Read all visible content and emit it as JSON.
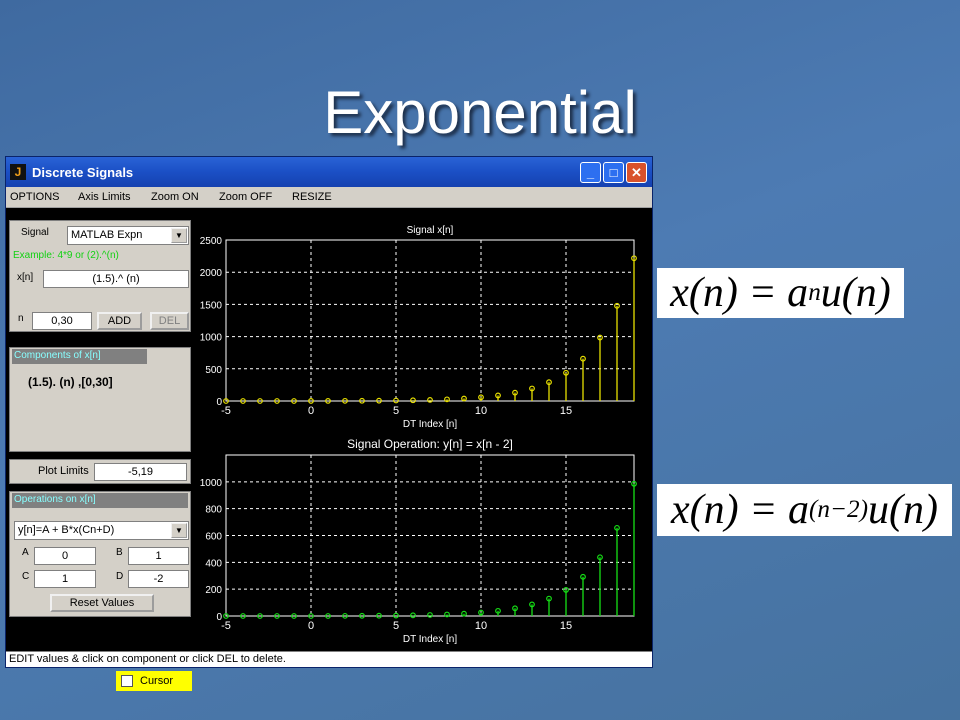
{
  "slide": {
    "title": "Exponential",
    "formula1": {
      "base": "x(n) = a",
      "exp": "n",
      "tail": "u(n)"
    },
    "formula2": {
      "base": "x(n) = a",
      "exp": "(n−2)",
      "tail": "u(n)"
    }
  },
  "window": {
    "title": "Discrete Signals",
    "menu": [
      "OPTIONS",
      "Axis Limits",
      "Zoom ON",
      "Zoom OFF",
      "RESIZE"
    ],
    "status": "EDIT values & click on component or click DEL to delete."
  },
  "signal_panel": {
    "signal_label": "Signal",
    "signal_select": "MATLAB Expn",
    "example": "Example: 4*9 or (2).^(n)",
    "xn_label": "x[n]",
    "xn_value": "(1.5).^ (n)",
    "n_label": "n",
    "n_value": "0,30",
    "add_label": "ADD",
    "del_label": "DEL"
  },
  "components_panel": {
    "header": "Components of x[n]",
    "item": "(1.5). (n) ,[0,30]"
  },
  "plot_limits": {
    "label": "Plot Limits",
    "value": "-5,19"
  },
  "operations_panel": {
    "header": "Operations on x[n]",
    "select": "y[n]=A + B*x(Cn+D)",
    "a_label": "A",
    "a_value": "0",
    "b_label": "B",
    "b_value": "1",
    "c_label": "C",
    "c_value": "1",
    "d_label": "D",
    "d_value": "-2",
    "reset_label": "Reset Values"
  },
  "cursor": {
    "label": "Cursor",
    "checked": false
  },
  "colors": {
    "signal": "#e8e000",
    "operation": "#16e016",
    "grid": "#ffffff"
  },
  "chart_data": [
    {
      "type": "stem",
      "title": "Signal  x[n]",
      "xlabel": "DT  Index   [n]",
      "xlim": [
        -5,
        19
      ],
      "ylim": [
        0,
        2500
      ],
      "xticks": [
        -5,
        0,
        5,
        10,
        15
      ],
      "yticks": [
        0,
        500,
        1000,
        1500,
        2000,
        2500
      ],
      "grid": true,
      "series": [
        {
          "x": [
            -5,
            -4,
            -3,
            -2,
            -1,
            0,
            1,
            2,
            3,
            4,
            5,
            6,
            7,
            8,
            9,
            10,
            11,
            12,
            13,
            14,
            15,
            16,
            17,
            18,
            19
          ],
          "values": [
            0,
            0,
            0,
            0,
            0,
            1,
            1.5,
            2.25,
            3.38,
            5.06,
            7.59,
            11.39,
            17.09,
            25.63,
            38.44,
            57.67,
            86.5,
            129.75,
            194.62,
            291.93,
            437.89,
            656.84,
            985.26,
            1477.89,
            2216.84
          ]
        }
      ]
    },
    {
      "type": "stem",
      "title": "Signal Operation: y[n] = x[n - 2]",
      "xlabel": "DT  Index   [n]",
      "xlim": [
        -5,
        19
      ],
      "ylim": [
        0,
        1200
      ],
      "xticks": [
        -5,
        0,
        5,
        10,
        15
      ],
      "yticks": [
        0,
        200,
        400,
        600,
        800,
        1000
      ],
      "grid": true,
      "series": [
        {
          "x": [
            -5,
            -4,
            -3,
            -2,
            -1,
            0,
            1,
            2,
            3,
            4,
            5,
            6,
            7,
            8,
            9,
            10,
            11,
            12,
            13,
            14,
            15,
            16,
            17,
            18,
            19
          ],
          "values": [
            0,
            0,
            0,
            0,
            0,
            0,
            0,
            1,
            1.5,
            2.25,
            3.38,
            5.06,
            7.59,
            11.39,
            17.09,
            25.63,
            38.44,
            57.67,
            86.5,
            129.75,
            194.62,
            291.93,
            437.89,
            656.84,
            985.26
          ]
        }
      ]
    }
  ]
}
